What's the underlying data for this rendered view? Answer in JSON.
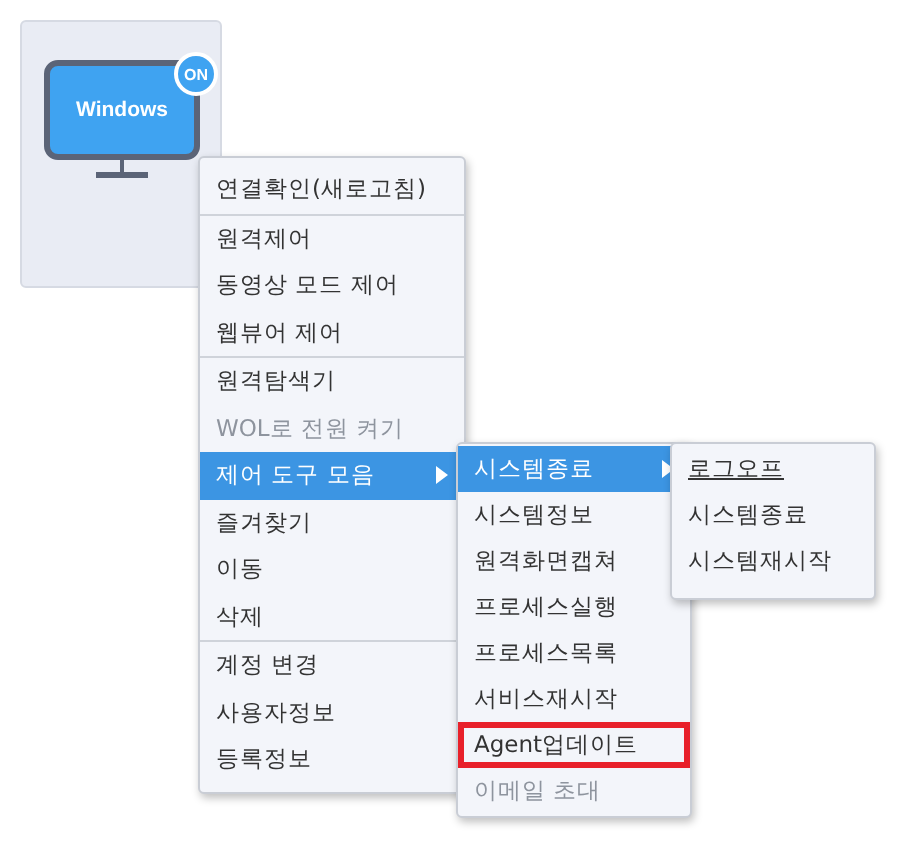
{
  "device": {
    "screen_label": "Windows",
    "status": "ON",
    "online": true
  },
  "context_menu": {
    "groups": [
      [
        {
          "label": "연결확인(새로고침)",
          "disabled": false,
          "selected": false,
          "has_submenu": false
        }
      ],
      [
        {
          "label": "원격제어",
          "disabled": false,
          "selected": false,
          "has_submenu": false
        },
        {
          "label": "동영상 모드 제어",
          "disabled": false,
          "selected": false,
          "has_submenu": false
        },
        {
          "label": "웹뷰어 제어",
          "disabled": false,
          "selected": false,
          "has_submenu": false
        }
      ],
      [
        {
          "label": "원격탐색기",
          "disabled": false,
          "selected": false,
          "has_submenu": false
        },
        {
          "label": "WOL로 전원 켜기",
          "disabled": true,
          "selected": false,
          "has_submenu": false
        },
        {
          "label": "제어 도구 모음",
          "disabled": false,
          "selected": true,
          "has_submenu": true
        },
        {
          "label": "즐겨찾기",
          "disabled": false,
          "selected": false,
          "has_submenu": false
        },
        {
          "label": "이동",
          "disabled": false,
          "selected": false,
          "has_submenu": false
        },
        {
          "label": "삭제",
          "disabled": false,
          "selected": false,
          "has_submenu": false
        }
      ],
      [
        {
          "label": "계정 변경",
          "disabled": false,
          "selected": false,
          "has_submenu": false
        },
        {
          "label": "사용자정보",
          "disabled": false,
          "selected": false,
          "has_submenu": false
        },
        {
          "label": "등록정보",
          "disabled": false,
          "selected": false,
          "has_submenu": false
        }
      ]
    ]
  },
  "tools_submenu": {
    "items": [
      {
        "label": "시스템종료",
        "disabled": false,
        "selected": true,
        "has_submenu": true,
        "highlighted": false
      },
      {
        "label": "시스템정보",
        "disabled": false,
        "selected": false,
        "has_submenu": false,
        "highlighted": false
      },
      {
        "label": "원격화면캡쳐",
        "disabled": false,
        "selected": false,
        "has_submenu": false,
        "highlighted": false
      },
      {
        "label": "프로세스실행",
        "disabled": false,
        "selected": false,
        "has_submenu": false,
        "highlighted": false
      },
      {
        "label": "프로세스목록",
        "disabled": false,
        "selected": false,
        "has_submenu": false,
        "highlighted": false
      },
      {
        "label": "서비스재시작",
        "disabled": false,
        "selected": false,
        "has_submenu": false,
        "highlighted": false
      },
      {
        "label": "Agent업데이트",
        "disabled": false,
        "selected": false,
        "has_submenu": false,
        "highlighted": true
      },
      {
        "label": "이메일 초대",
        "disabled": true,
        "selected": false,
        "has_submenu": false,
        "highlighted": false
      }
    ]
  },
  "shutdown_submenu": {
    "items": [
      {
        "label": "로그오프",
        "hovered": true
      },
      {
        "label": "시스템종료",
        "hovered": false
      },
      {
        "label": "시스템재시작",
        "hovered": false
      }
    ]
  }
}
